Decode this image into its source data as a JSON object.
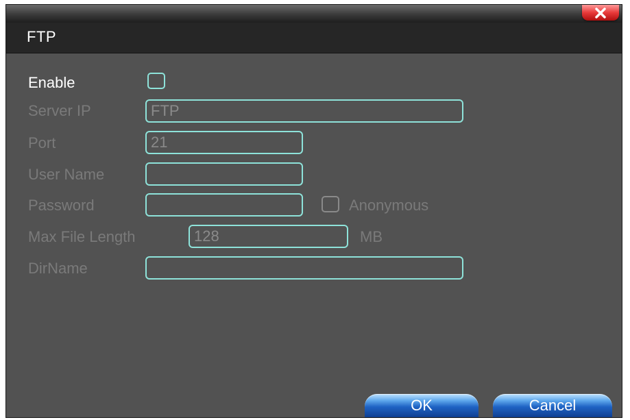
{
  "window": {
    "title": "FTP",
    "close_icon": "close-x-icon"
  },
  "form": {
    "enable": {
      "label": "Enable",
      "checked": false
    },
    "server_ip": {
      "label": "Server IP",
      "value": "FTP"
    },
    "port": {
      "label": "Port",
      "value": "21"
    },
    "user_name": {
      "label": "User Name",
      "value": ""
    },
    "password": {
      "label": "Password",
      "value": ""
    },
    "anonymous": {
      "label": "Anonymous",
      "checked": false
    },
    "max_file_length": {
      "label": "Max File Length",
      "value": "128",
      "unit": "MB"
    },
    "dir_name": {
      "label": "DirName",
      "value": ""
    }
  },
  "buttons": {
    "ok_label": "OK",
    "cancel_label": "Cancel"
  },
  "colors": {
    "field_border": "#8ee3da",
    "panel_bg": "#525252",
    "disabled_text": "#7a7a7a",
    "close_button": "#e83a3a",
    "button_blue": "#1f63c4"
  }
}
